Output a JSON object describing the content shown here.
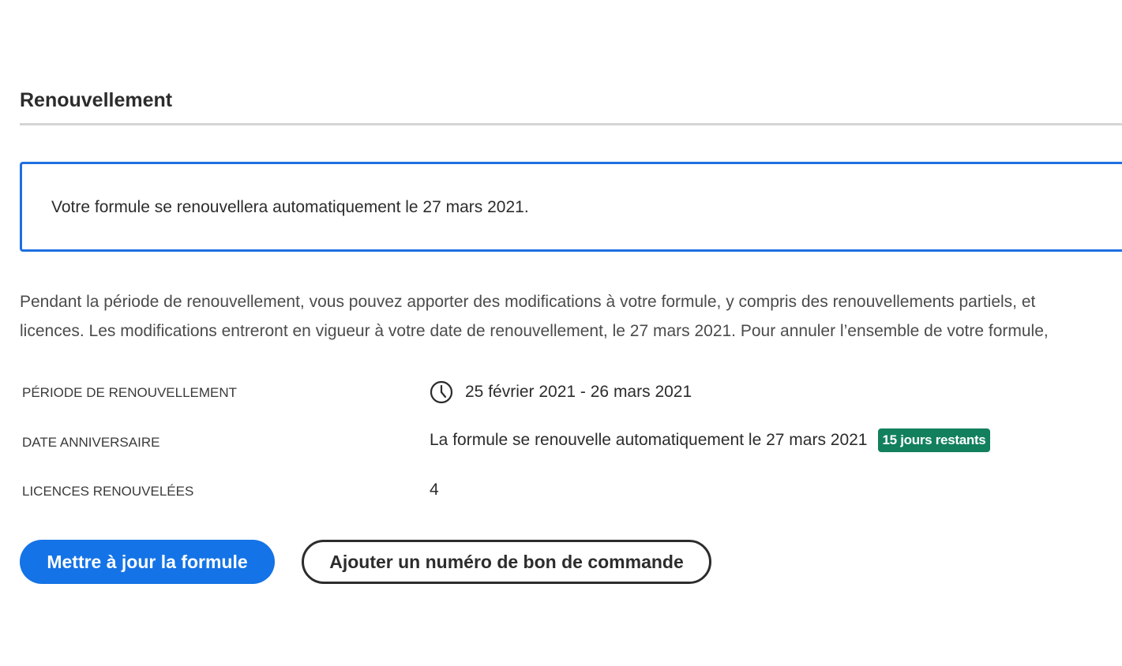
{
  "renewal": {
    "title": "Renouvellement",
    "notice": "Votre formule se renouvellera automatiquement le 27 mars 2021.",
    "description_line1": "Pendant la période de renouvellement, vous pouvez apporter des modifications à votre formule, y compris des renouvellements partiels, et",
    "description_line2": "licences. Les modifications entreront en vigueur à votre date de renouvellement, le 27 mars 2021. Pour annuler l’ensemble de votre formule,",
    "details": {
      "period_label": "PÉRIODE DE RENOUVELLEMENT",
      "period_value": "25 février 2021 - 26 mars 2021",
      "anniversary_label": "DATE ANNIVERSAIRE",
      "anniversary_value": "La formule se renouvelle automatiquement le 27 mars 2021",
      "days_badge": "15 jours restants",
      "licenses_label": "LICENCES RENOUVELÉES",
      "licenses_value": "4"
    },
    "buttons": {
      "update_plan": "Mettre à jour la formule",
      "add_po_number": "Ajouter un numéro de bon de commande"
    },
    "colors": {
      "accent": "#1473e6",
      "notice_border": "#1f6fe0",
      "badge_bg": "#12805c"
    },
    "icons": {
      "period_icon": "clock-icon"
    }
  }
}
